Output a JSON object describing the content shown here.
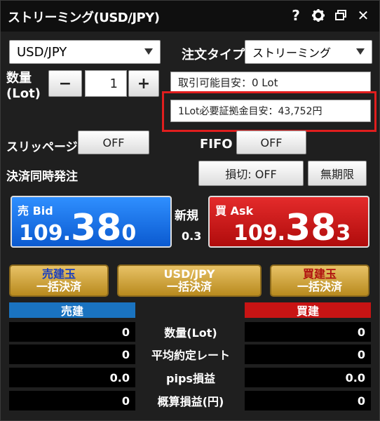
{
  "window": {
    "title": "ストリーミング(USD/JPY)",
    "icons": [
      "help-icon",
      "gear-icon",
      "restore-icon",
      "close-icon"
    ],
    "help_glyph": "?",
    "close_glyph": "✕"
  },
  "order": {
    "pair_select": "USD/JPY",
    "order_type_label": "注文タイプ",
    "order_type_value": "ストリーミング",
    "quantity_label_line1": "数量",
    "quantity_label_line2": "(Lot)",
    "minus": "−",
    "plus": "+",
    "quantity_value": "1",
    "tradable_info": "取引可能目安：0 Lot",
    "margin_info": "1Lot必要証拠金目安：43,752円",
    "slippage_label": "スリッページ",
    "slippage_value": "OFF",
    "fifo_label": "FIFO",
    "fifo_value": "OFF",
    "oco_label": "決済同時発注",
    "stoploss_value": "損切: OFF",
    "expiry_value": "無期限"
  },
  "quote": {
    "bid_label": "売 Bid",
    "bid_prefix": "109.",
    "bid_big": "38",
    "bid_suffix": "0",
    "ask_label": "買 Ask",
    "ask_prefix": "109.",
    "ask_big": "38",
    "ask_suffix": "3",
    "spread_label": "新規",
    "spread_value": "0.3"
  },
  "settle": {
    "sell_line1": "売建玉",
    "sell_line2": "一括決済",
    "pair_line1": "USD/JPY",
    "pair_line2": "一括決済",
    "buy_line1": "買建玉",
    "buy_line2": "一括決済"
  },
  "positions": {
    "sell_header": "売建",
    "buy_header": "買建",
    "rows": [
      {
        "label": "数量(Lot)",
        "sell": "0",
        "buy": "0"
      },
      {
        "label": "平均約定レート",
        "sell": "0",
        "buy": "0"
      },
      {
        "label": "pips損益",
        "sell": "0.0",
        "buy": "0.0"
      },
      {
        "label": "概算損益(円)",
        "sell": "0",
        "buy": "0"
      }
    ]
  },
  "colors": {
    "bid": "#1a73e8",
    "ask": "#c81414",
    "highlight": "#e01e1e",
    "gold": "#d4a73c"
  }
}
